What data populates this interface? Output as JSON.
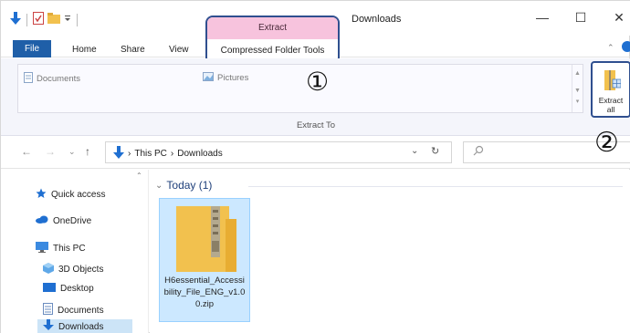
{
  "window": {
    "title": "Downloads",
    "controls": {
      "minimize": "—",
      "maximize": "☐",
      "close": "✕"
    }
  },
  "tabs": {
    "file": "File",
    "home": "Home",
    "share": "Share",
    "view": "View",
    "context_group": {
      "label": "Extract",
      "tab": "Compressed Folder Tools"
    }
  },
  "ribbon": {
    "destinations": [
      "Documents",
      "Pictures"
    ],
    "group_label": "Extract To",
    "extract_all_label": "Extract\nall"
  },
  "address_bar": {
    "path": [
      "This PC",
      "Downloads"
    ],
    "separator": "›"
  },
  "nav_pane": {
    "items": [
      {
        "label": "Quick access",
        "icon": "star-icon"
      },
      {
        "label": "OneDrive",
        "icon": "cloud-icon"
      },
      {
        "label": "This PC",
        "icon": "computer-icon"
      },
      {
        "label": "3D Objects",
        "icon": "cube-icon"
      },
      {
        "label": "Desktop",
        "icon": "desktop-icon"
      },
      {
        "label": "Documents",
        "icon": "document-icon"
      },
      {
        "label": "Downloads",
        "icon": "download-icon",
        "selected": true
      }
    ]
  },
  "content": {
    "group_header": "Today (1)",
    "file": {
      "name": "H6essential_Accessibility_File_ENG_v1.00.zip",
      "icon": "zip-folder-icon"
    }
  },
  "callouts": [
    "①",
    "②"
  ],
  "colors": {
    "file_tab": "#1f5fa8",
    "context_tab": "#f7c3dd",
    "callout_border": "#2f4f8f",
    "selection": "#cce8ff",
    "folder": "#f2c14e"
  }
}
